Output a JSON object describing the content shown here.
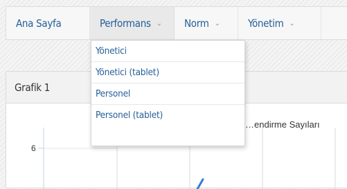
{
  "nav": {
    "items": [
      {
        "label": "Ana Sayfa",
        "has_dropdown": false,
        "active": false
      },
      {
        "label": "Performans",
        "has_dropdown": true,
        "active": true
      },
      {
        "label": "Norm",
        "has_dropdown": true,
        "active": false
      },
      {
        "label": "Yönetim",
        "has_dropdown": true,
        "active": false
      }
    ],
    "chevron": "⌄"
  },
  "dropdown": {
    "items": [
      {
        "label": "Yönetici"
      },
      {
        "label": "Yönetici (tablet)"
      },
      {
        "label": "Personel"
      },
      {
        "label": "Personel (tablet)"
      }
    ]
  },
  "panel": {
    "title": "Grafik 1"
  },
  "chart_data": {
    "type": "line",
    "title": "…endirme Sayıları",
    "y_tick_labels": [
      "6"
    ],
    "series": [
      {
        "color": "#2f7ed8"
      }
    ],
    "colors": {
      "axis": "#c0d0e0",
      "grid": "#d8d8d8",
      "line": "#2f7ed8"
    }
  },
  "colors": {
    "link": "#245e99",
    "nav_bg": "#f7f7f7",
    "nav_active_bg": "#e9e9e9",
    "panel_head_bg": "#f2f2f2"
  }
}
